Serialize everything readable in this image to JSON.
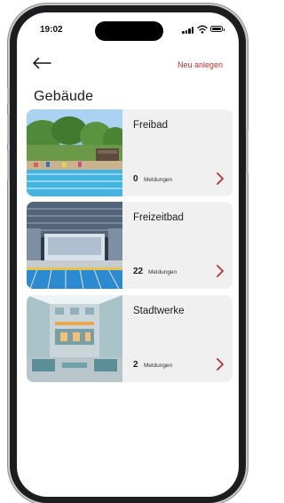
{
  "status_bar": {
    "time": "19:02"
  },
  "nav": {
    "new_label": "Neu anlegen"
  },
  "page": {
    "title": "Gebäude"
  },
  "buildings": [
    {
      "name": "Freibad",
      "count": "0",
      "count_label": "Meldungen",
      "image": "outdoor-pool-photo"
    },
    {
      "name": "Freizeitbad",
      "count": "22",
      "count_label": "Meldungen",
      "image": "indoor-pool-photo"
    },
    {
      "name": "Stadtwerke",
      "count": "2",
      "count_label": "Meldungen",
      "image": "atrium-building-photo"
    }
  ],
  "colors": {
    "accent": "#b7312c",
    "card_bg": "#f0f0f1",
    "frame": "#1d1d1f"
  }
}
